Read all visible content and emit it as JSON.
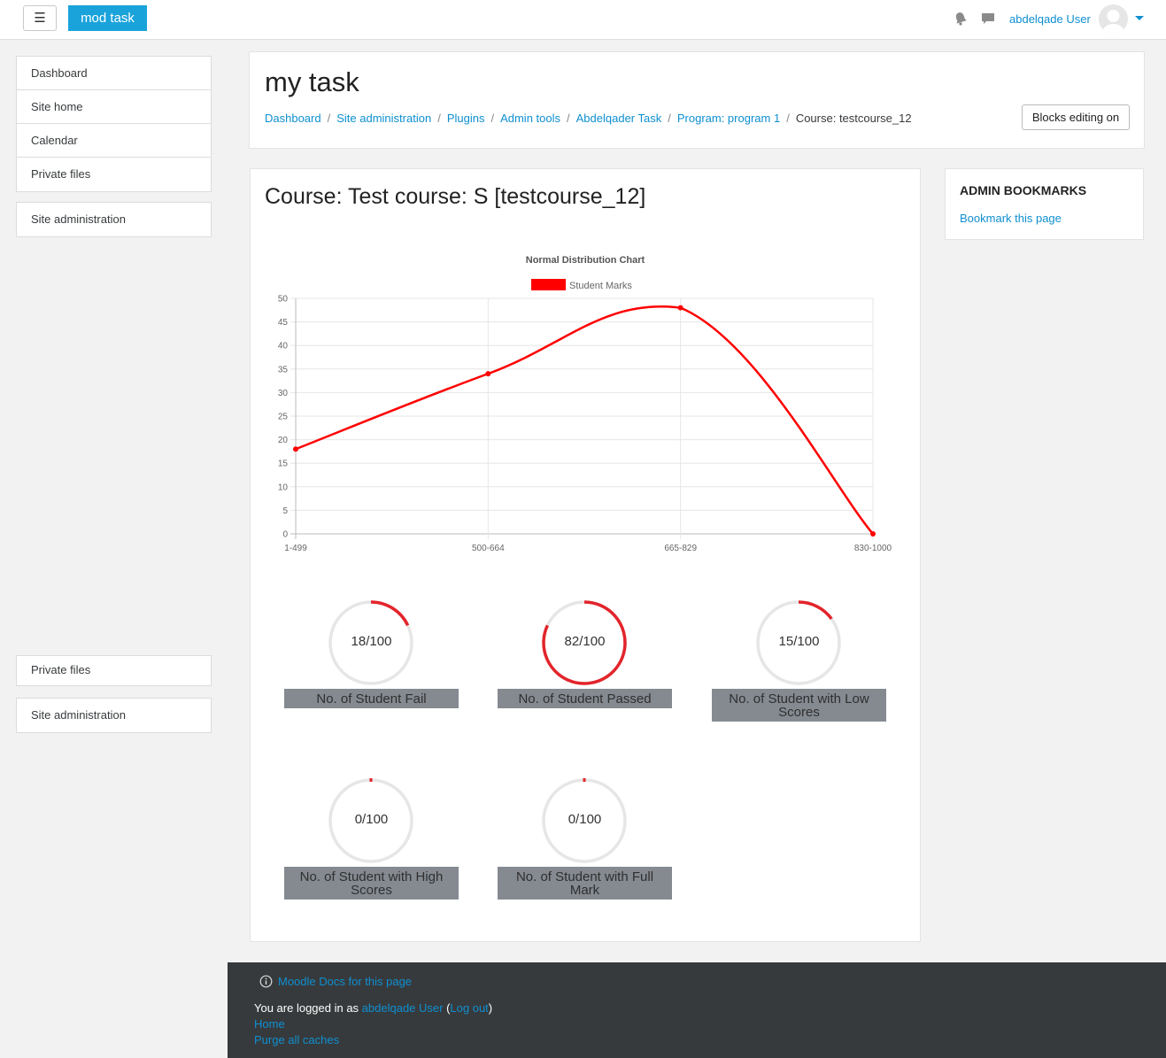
{
  "navbar": {
    "menu_icon": "☰",
    "brand": "mod task",
    "username": "abdelqade User",
    "icons": [
      "bell-icon",
      "chat-icon",
      "avatar",
      "caret-down-icon"
    ]
  },
  "drawer": {
    "group1": [
      "Dashboard",
      "Site home",
      "Calendar",
      "Private files"
    ],
    "group2": [
      "Site administration"
    ],
    "group3": [
      "Private files"
    ],
    "group4": [
      "Site administration"
    ]
  },
  "header": {
    "title": "my task",
    "breadcrumb": [
      "Dashboard",
      "Site administration",
      "Plugins",
      "Admin tools",
      "Abdelqader Task",
      "Program: program 1"
    ],
    "breadcrumb_current": "Course: testcourse_12",
    "blocks_button": "Blocks editing on"
  },
  "main": {
    "course_title": "Course: Test course: S [testcourse_12]"
  },
  "chart_data": {
    "type": "line",
    "title": "Normal Distribution Chart",
    "categories": [
      "1-499",
      "500-664",
      "665-829",
      "830-1000"
    ],
    "series": [
      {
        "name": "Student Marks",
        "values": [
          18,
          34,
          48,
          0
        ],
        "color": "#ff0000"
      }
    ],
    "ylim": [
      0,
      50
    ],
    "yticks": [
      0,
      5,
      10,
      15,
      20,
      25,
      30,
      35,
      40,
      45,
      50
    ],
    "grid": true,
    "legend": "top"
  },
  "gauges": [
    {
      "value": 18,
      "max": 100,
      "text": "18/100",
      "label": "No. of Student Fail"
    },
    {
      "value": 82,
      "max": 100,
      "text": "82/100",
      "label": "No. of Student Passed"
    },
    {
      "value": 15,
      "max": 100,
      "text": "15/100",
      "label": "No. of Student with Low Scores"
    },
    {
      "value": 0,
      "max": 100,
      "text": "0/100",
      "label": "No. of Student with High Scores"
    },
    {
      "value": 0,
      "max": 100,
      "text": "0/100",
      "label": "No. of Student with Full Mark"
    }
  ],
  "bookmarks": {
    "title": "ADMIN BOOKMARKS",
    "link": "Bookmark this page"
  },
  "footer": {
    "docs_link": "Moodle Docs for this page",
    "logged_prefix": "You are logged in as ",
    "user_link": "abdelqade User",
    "paren_open": " (",
    "logout": "Log out",
    "paren_close": ")",
    "home": "Home",
    "purge": "Purge all caches"
  },
  "colors": {
    "accent": "#1aa3db",
    "link": "#0f8fd1",
    "series": "#ff0000",
    "gauge_arc": "#e3242b",
    "gauge_track": "#e6e6e6",
    "label_bg": "#858a91",
    "footer_bg": "#373a3c"
  }
}
